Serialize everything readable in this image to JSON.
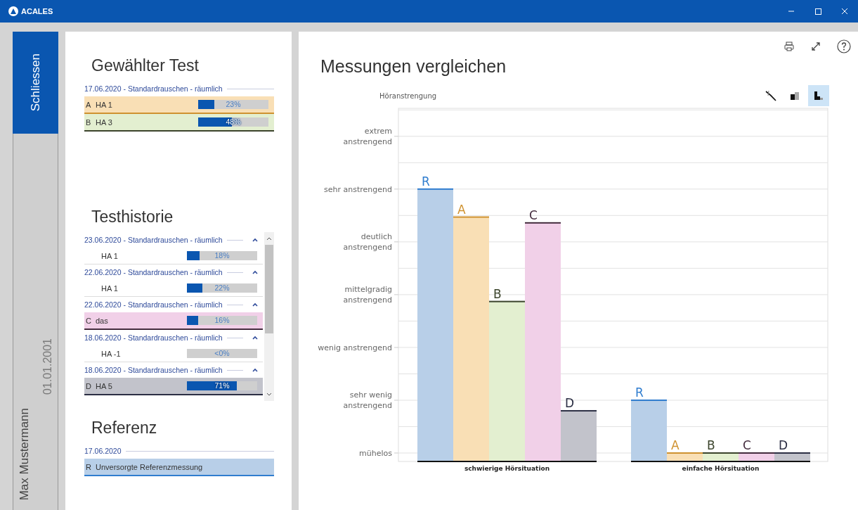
{
  "window": {
    "title": "ACALES"
  },
  "side_tabs": [
    {
      "label": "Schliessen",
      "selected": true
    },
    {
      "label": "Max Mustermann",
      "sublabel": "01.01.2001",
      "selected": false
    }
  ],
  "selected_test": {
    "heading": "Gewählter Test",
    "groups": [
      {
        "header": "17.06.2020 - Standardrauschen - räumlich",
        "rows": [
          {
            "letter": "A",
            "name": "HA 1",
            "level": 0.23,
            "percent": "23%",
            "color": "#f9dfb5"
          },
          {
            "letter": "B",
            "name": "HA 3",
            "level": 0.48,
            "percent": "48%",
            "color": "#e3efd0"
          }
        ]
      }
    ]
  },
  "history": {
    "heading": "Testhistorie",
    "groups": [
      {
        "header": "23.06.2020 - Standardrauschen - räumlich",
        "expanded": true,
        "rows": [
          {
            "name": "HA 1",
            "level": 0.18,
            "percent": "18%"
          }
        ]
      },
      {
        "header": "22.06.2020 - Standardrauschen - räumlich",
        "expanded": true,
        "rows": [
          {
            "name": "HA 1",
            "level": 0.22,
            "percent": "22%"
          }
        ]
      },
      {
        "header": "22.06.2020 - Standardrauschen - räumlich",
        "expanded": true,
        "rows": [
          {
            "letter": "C",
            "name": "das",
            "level": 0.16,
            "percent": "16%",
            "color": "#f1d0e8"
          }
        ]
      },
      {
        "header": "18.06.2020 - Standardrauschen - räumlich",
        "expanded": true,
        "rows": [
          {
            "name": "HA -1",
            "level": 0,
            "percent": "<0%"
          }
        ]
      },
      {
        "header": "18.06.2020 - Standardrauschen - räumlich",
        "expanded": true,
        "rows": [
          {
            "letter": "D",
            "name": "HA 5",
            "level": 0.71,
            "percent": "71%",
            "color": "#c2c3cb"
          }
        ]
      }
    ]
  },
  "reference": {
    "heading": "Referenz",
    "groups": [
      {
        "header": "17.06.2020",
        "rows": [
          {
            "letter": "R",
            "name": "Unversorgte Referenzmessung",
            "color": "#b8cfe8"
          }
        ]
      }
    ]
  },
  "comparison": {
    "heading": "Messungen vergleichen",
    "chart_types": [
      {
        "kind": "line",
        "selected": false
      },
      {
        "kind": "stacked",
        "selected": false
      },
      {
        "kind": "grouped",
        "selected": true
      }
    ],
    "chart": {
      "axis_title": "Höranstrengung",
      "y_labels": [
        "extrem\nanstrengend",
        "sehr anstrengend",
        "deutlich\nanstrengend",
        "mittelgradig\nanstrengend",
        "wenig anstrengend",
        "sehr wenig\nanstrengend",
        "mühelos"
      ],
      "groups": [
        {
          "label": "schwierige Hörsituation",
          "bars": [
            {
              "letter": "R",
              "color": "#b8cfe8"
            },
            {
              "letter": "A",
              "color": "#f9dfb5"
            },
            {
              "letter": "B",
              "color": "#e3efd0"
            },
            {
              "letter": "C",
              "color": "#f1d0e8"
            },
            {
              "letter": "D",
              "color": "#c2c3cb"
            }
          ]
        },
        {
          "label": "einfache Hörsituation",
          "bars": [
            {
              "letter": "R",
              "color": "#b8cfe8"
            },
            {
              "letter": "A",
              "color": "#f9dfb5"
            },
            {
              "letter": "B",
              "color": "#e3efd0"
            },
            {
              "letter": "C",
              "color": "#f1d0e8"
            },
            {
              "letter": "D",
              "color": "#c2c3cb"
            }
          ]
        }
      ]
    }
  }
}
